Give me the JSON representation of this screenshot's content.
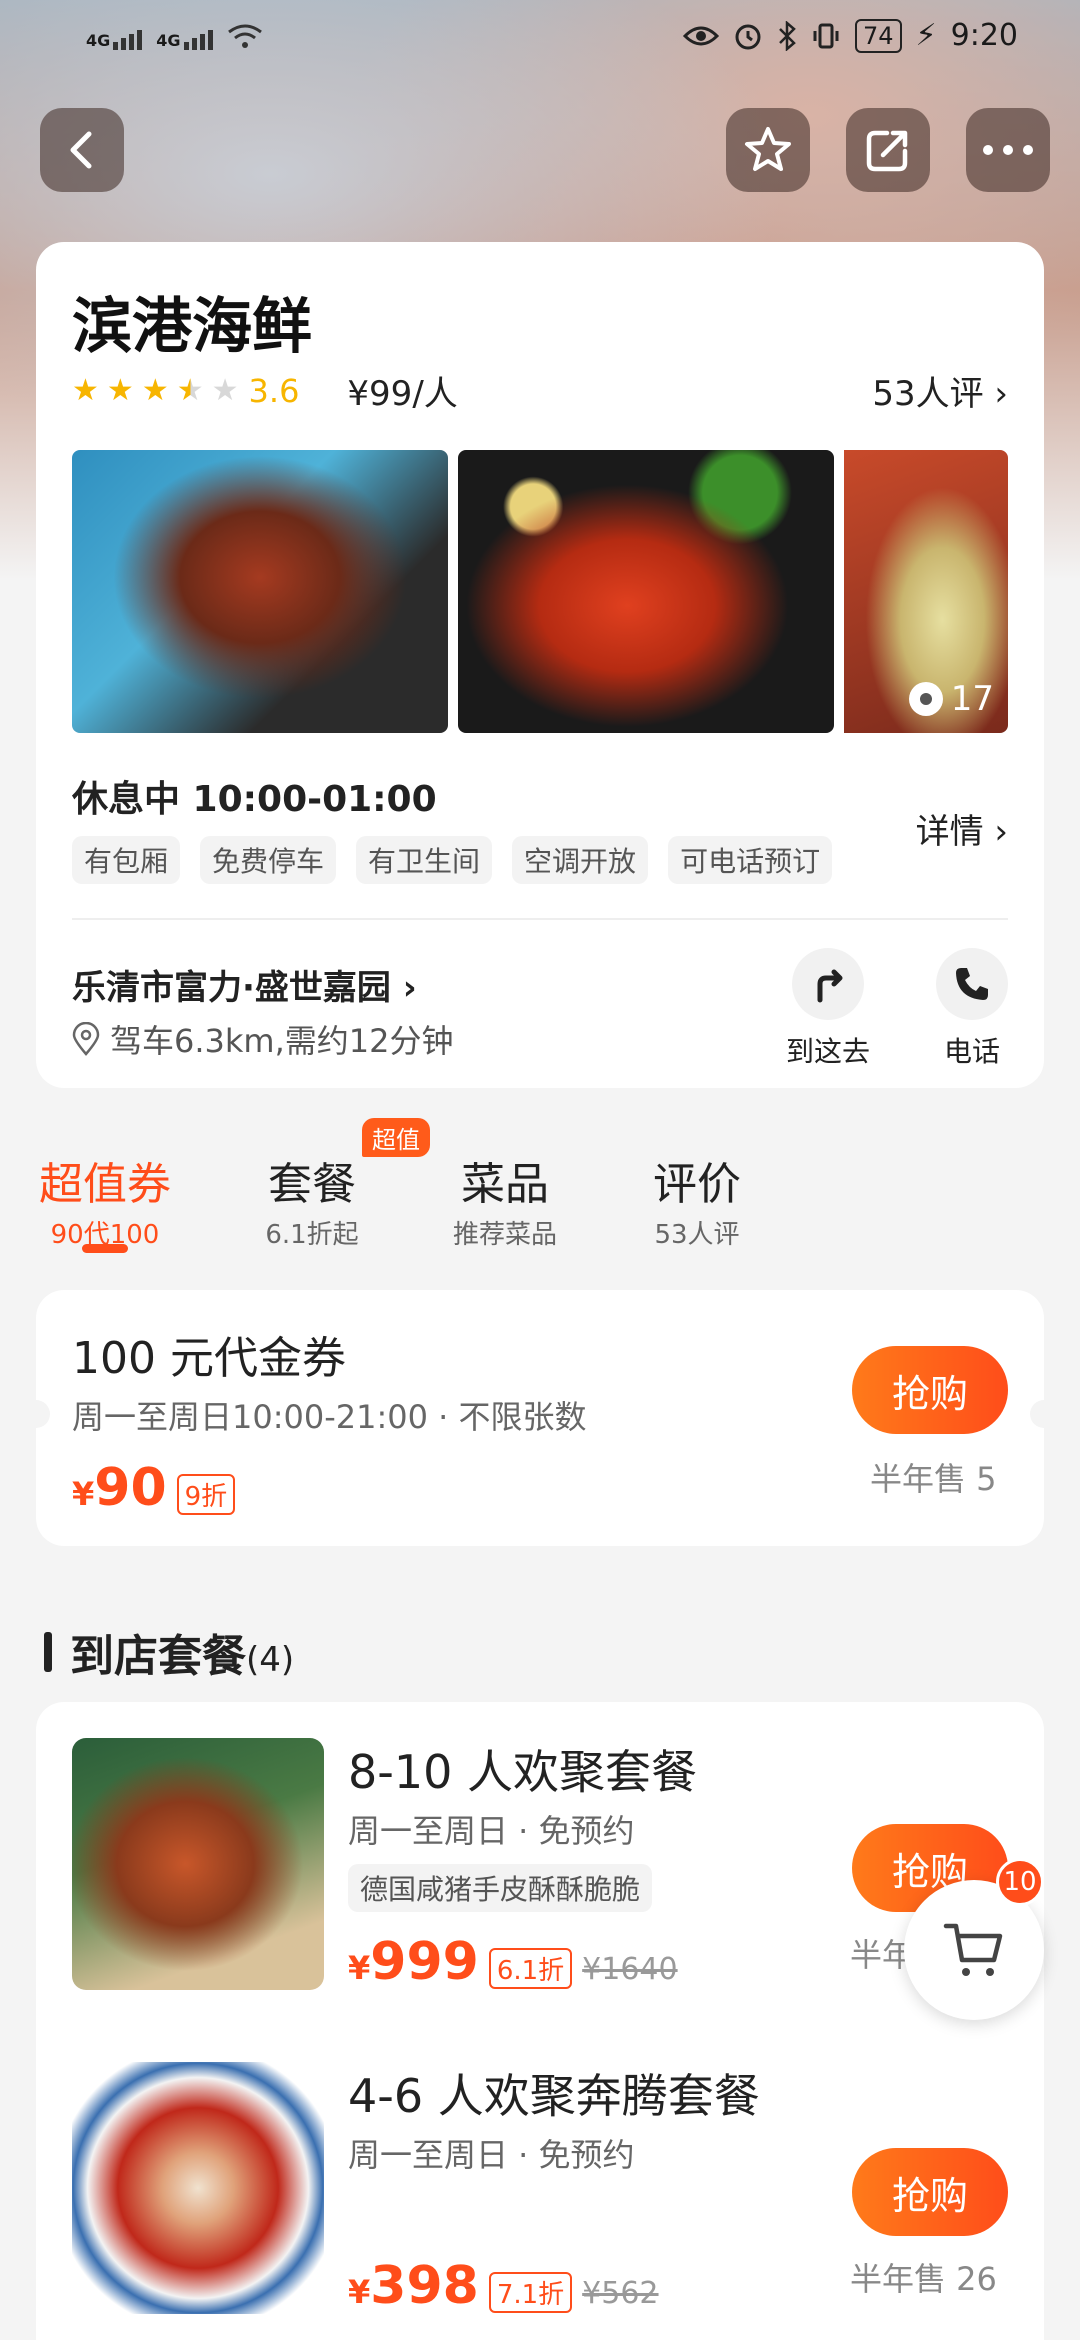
{
  "status_bar": {
    "network_1": "4G",
    "network_2": "4G",
    "battery": "74",
    "time": "9:20"
  },
  "store": {
    "name": "滨港海鲜",
    "rating": 3.6,
    "rating_text": "3.6",
    "price_per_person": "¥99/人",
    "review_count": "53人评",
    "photo_count": "17",
    "hours": "休息中 10:00-01:00",
    "detail_label": "详情",
    "facilities": [
      "有包厢",
      "免费停车",
      "有卫生间",
      "空调开放",
      "可电话预订"
    ],
    "address": "乐清市富力·盛世嘉园",
    "distance": "驾车6.3km,需约12分钟",
    "navigate_label": "到这去",
    "phone_label": "电话"
  },
  "tabs": [
    {
      "label": "超值券",
      "sub": "90代100",
      "active": true
    },
    {
      "label": "套餐",
      "sub": "6.1折起",
      "badge": "超值"
    },
    {
      "label": "菜品",
      "sub": "推荐菜品"
    },
    {
      "label": "评价",
      "sub": "53人评"
    }
  ],
  "voucher": {
    "title": "100 元代金券",
    "sub": "周一至周日10:00-21:00 · 不限张数",
    "currency": "¥",
    "price": "90",
    "discount": "9折",
    "buy_label": "抢购",
    "sold": "半年售 5"
  },
  "packages_section": {
    "title": "到店套餐",
    "count": "(4)"
  },
  "packages": [
    {
      "title": "8-10 人欢聚套餐",
      "sub": "周一至周日 · 免预约",
      "tag": "德国咸猪手皮酥酥脆脆",
      "currency": "¥",
      "price": "999",
      "discount": "6.1折",
      "original": "¥1640",
      "buy_label": "抢购",
      "sold": "半年"
    },
    {
      "title": "4-6 人欢聚奔腾套餐",
      "sub": "周一至周日 · 免预约",
      "currency": "¥",
      "price": "398",
      "discount": "7.1折",
      "original": "¥562",
      "buy_label": "抢购",
      "sold": "半年售 26"
    }
  ],
  "cart": {
    "count": "10"
  },
  "colors": {
    "accent": "#ff4d1a",
    "star": "#f7b500"
  }
}
